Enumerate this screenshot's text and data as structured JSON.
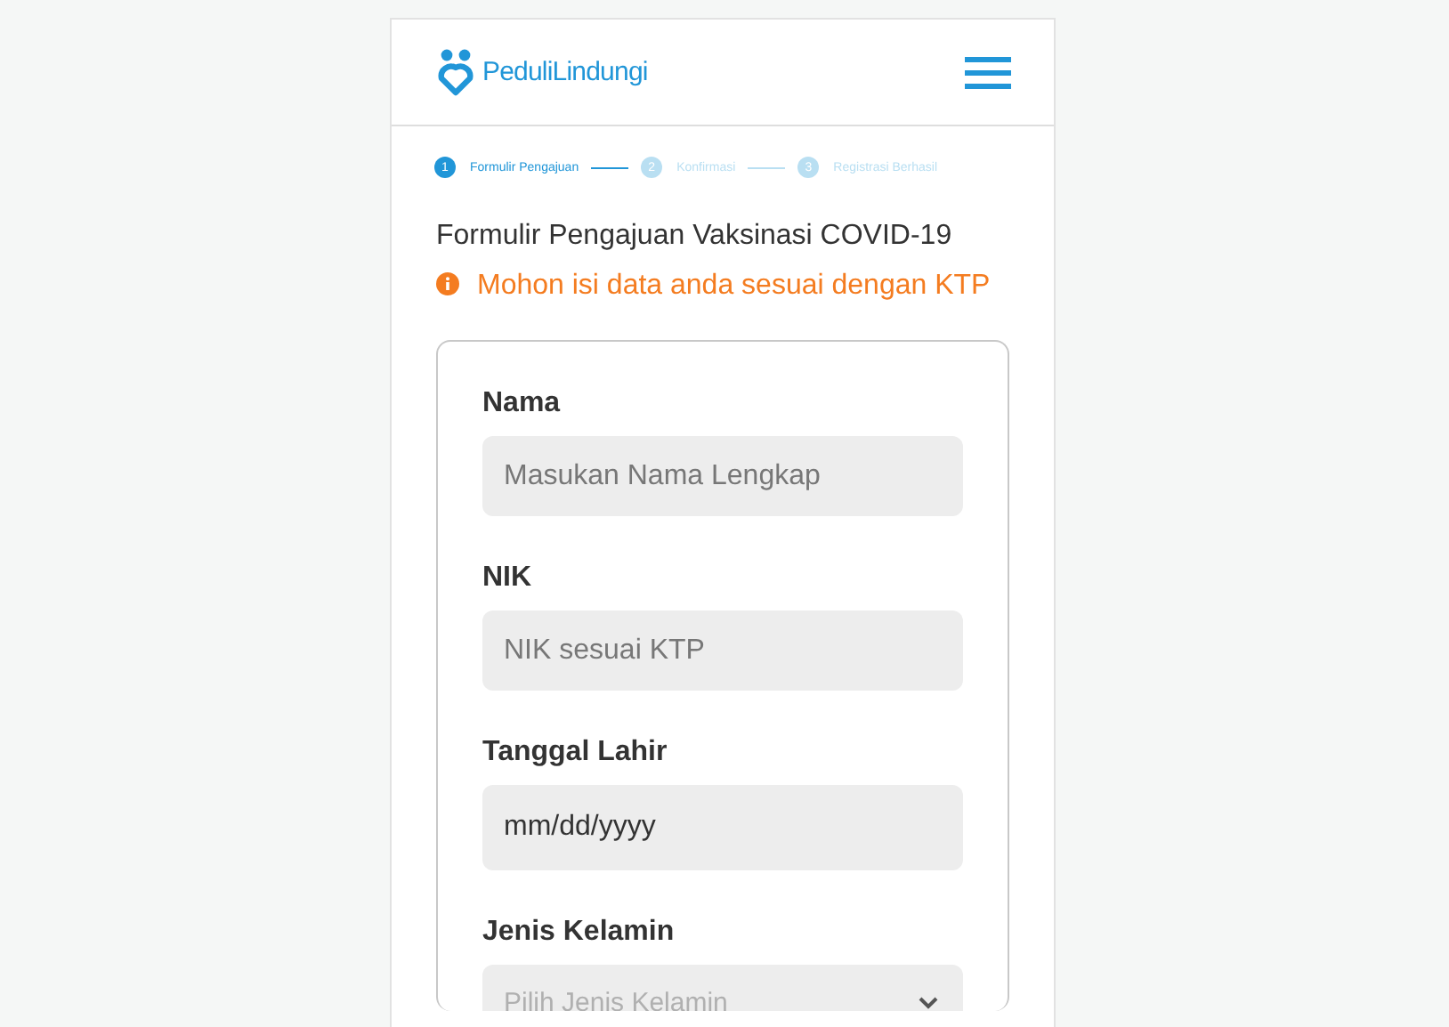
{
  "header": {
    "logo_text": "PeduliLindungi"
  },
  "steps": [
    {
      "number": "1",
      "label": "Formulir Pengajuan",
      "selected": true
    },
    {
      "number": "2",
      "label": "Konfirmasi",
      "selected": false
    },
    {
      "number": "3",
      "label": "Registrasi Berhasil",
      "selected": false
    }
  ],
  "title": "Formulir Pengajuan Vaksinasi COVID-19",
  "notice": "Mohon isi data anda sesuai dengan KTP",
  "fields": [
    {
      "kind": "text",
      "label": "Nama",
      "placeholder": "Masukan Nama Lengkap"
    },
    {
      "kind": "text",
      "label": "NIK",
      "placeholder": "NIK sesuai KTP"
    },
    {
      "kind": "date",
      "label": "Tanggal Lahir",
      "value": "mm/dd/yyyy"
    },
    {
      "kind": "select",
      "label": "Jenis Kelamin",
      "placeholder": "Pilih Jenis Kelamin"
    }
  ]
}
